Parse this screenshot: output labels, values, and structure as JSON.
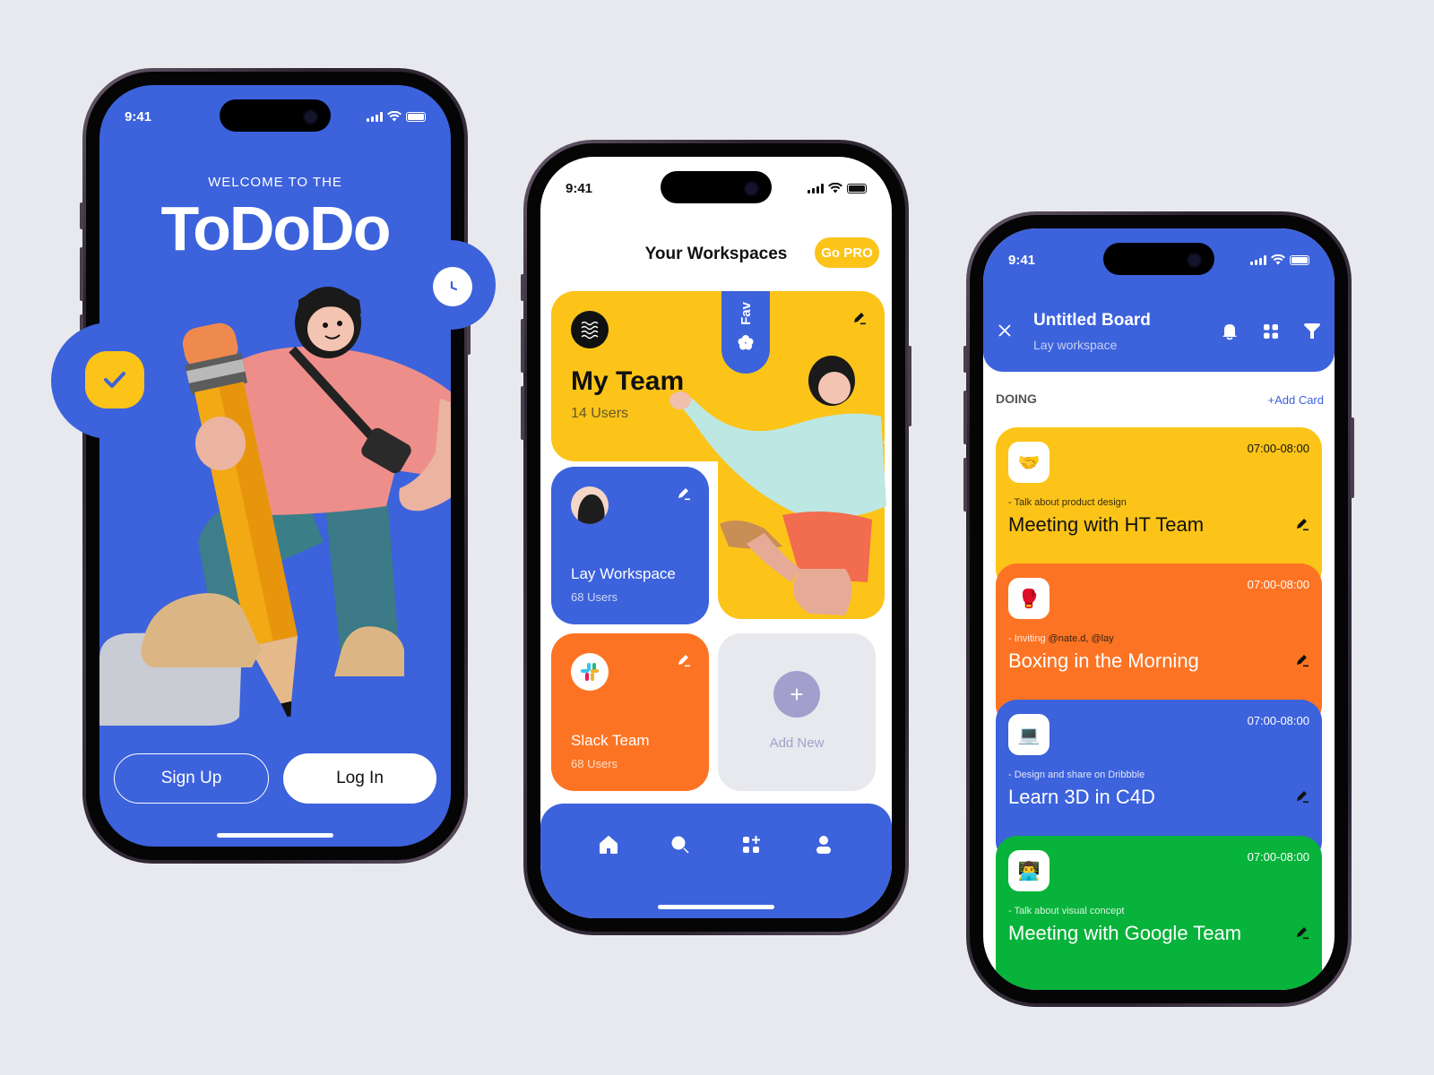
{
  "colors": {
    "brand_blue": "#3c62dc",
    "yellow": "#fcc419",
    "orange": "#fc7423",
    "green": "#07b33a",
    "lavender": "#a39fcd",
    "background": "#e8e9ee"
  },
  "status_bar": {
    "time": "9:41"
  },
  "welcome_screen": {
    "eyebrow": "WELCOME TO THE",
    "app_name": "ToDoDo",
    "badges": {
      "check": "check-icon",
      "clock": "clock-icon"
    },
    "illustration": "3D character holding a giant pencil",
    "buttons": {
      "sign_up": "Sign Up",
      "log_in": "Log In"
    }
  },
  "workspaces_screen": {
    "title": "Your Workspaces",
    "go_pro": "Go PRO",
    "featured": {
      "name": "My Team",
      "users": "14 Users",
      "fav_label": "Fav",
      "illustration": "3D jumping character"
    },
    "cards": [
      {
        "name": "Lay  Workspace",
        "users": "68 Users",
        "color": "blue"
      },
      {
        "name": "Slack Team",
        "users": "68 Users",
        "color": "orange"
      }
    ],
    "add_new": "Add New",
    "tabbar": [
      "home-icon",
      "search-icon",
      "apps-add-icon",
      "profile-icon"
    ]
  },
  "board_screen": {
    "title": "Untitled Board",
    "subtitle": "Lay workspace",
    "header_icons": [
      "bell-icon",
      "grid-icon",
      "filter-icon"
    ],
    "column": "DOING",
    "add_card": "+Add Card",
    "tasks": [
      {
        "emoji": "🤝",
        "time": "07:00-08:00",
        "desc": "- Talk about product design",
        "desc_mentions": "",
        "title": "Meeting with HT Team",
        "color": "#fcc419",
        "text_color": "#111111"
      },
      {
        "emoji": "🥊",
        "time": "07:00-08:00",
        "desc": "- Inviting ",
        "desc_mentions": "@nate.d, @lay",
        "title": "Boxing in the Morning",
        "color": "#fc7423",
        "text_color": "#ffffff"
      },
      {
        "emoji": "💻",
        "time": "07:00-08:00",
        "desc": "- Design and share on Dribbble",
        "desc_mentions": "",
        "title": "Learn 3D in C4D",
        "color": "#3c62dc",
        "text_color": "#ffffff"
      },
      {
        "emoji": "👨‍💻",
        "time": "07:00-08:00",
        "desc": "- Talk about visual concept",
        "desc_mentions": "",
        "title": "Meeting with Google Team",
        "color": "#07b33a",
        "text_color": "#ffffff"
      }
    ]
  }
}
